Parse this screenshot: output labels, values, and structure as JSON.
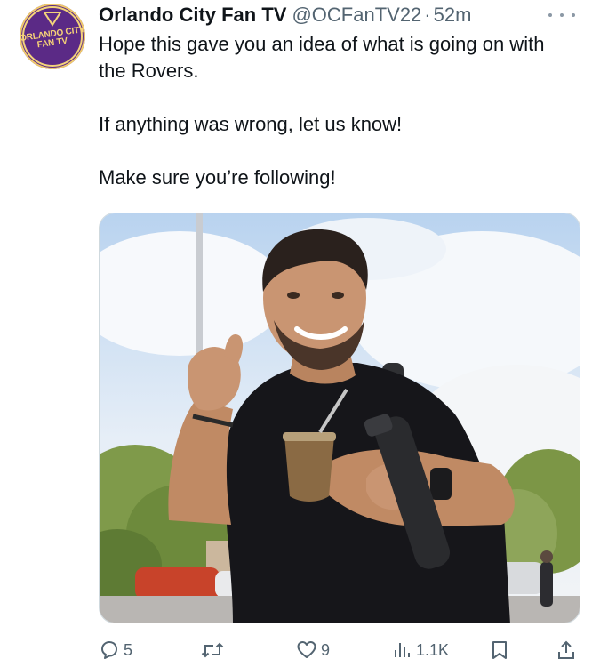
{
  "account": {
    "display_name": "Orlando City Fan TV",
    "handle": "@OCFanTV22",
    "separator": "·",
    "time": "52m",
    "avatar_line1": "ORLANDO CITY",
    "avatar_line2": "FAN TV",
    "avatar_icon": "orlando-city-crest-logo"
  },
  "tweet": {
    "text": "Hope this gave you an idea of what is going on with the Rovers.\n\nIf anything was wrong, let us know!\n\nMake sure you’re following!"
  },
  "media": {
    "description_icon": "photo",
    "shirt_color": "#16161a",
    "sky_color": "#9fc3e8"
  },
  "actions": {
    "reply": {
      "icon": "reply-icon",
      "count": "5"
    },
    "retweet": {
      "icon": "retweet-icon",
      "count": ""
    },
    "like": {
      "icon": "heart-icon",
      "count": "9"
    },
    "views": {
      "icon": "views-icon",
      "count": "1.1K"
    },
    "bookmark": {
      "icon": "bookmark-icon"
    },
    "share": {
      "icon": "share-icon"
    }
  },
  "colors": {
    "text": "#0f1419",
    "muted": "#536471",
    "avatar_bg": "#5b2a86",
    "avatar_gold": "#f3d37a"
  }
}
